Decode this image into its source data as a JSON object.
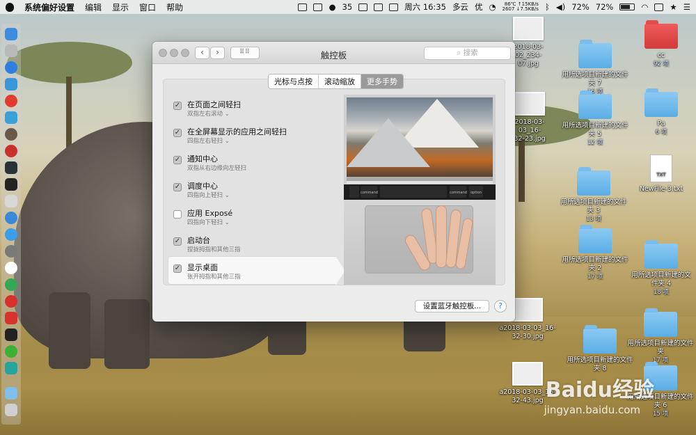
{
  "menubar": {
    "app_name": "系统偏好设置",
    "menus": [
      "编辑",
      "显示",
      "窗口",
      "帮助"
    ],
    "status": {
      "wechat_count": "35",
      "datetime": "周六 16:35",
      "weather": "多云",
      "quality": "优",
      "temp": "86℃",
      "cpu": "2607",
      "net_up": "↑15KB/s",
      "net_down": "↓7.5KB/s",
      "battery_left": "72%",
      "battery_right": "72%"
    }
  },
  "window": {
    "title": "触控板",
    "search_placeholder": "搜索",
    "tabs": [
      "光标与点按",
      "滚动缩放",
      "更多手势"
    ],
    "active_tab": "更多手势",
    "options": [
      {
        "title": "在页面之间轻扫",
        "sub": "双指左右滚动 ⌄",
        "checked": "✓"
      },
      {
        "title": "在全屏幕显示的应用之间轻扫",
        "sub": "四指左右轻扫 ⌄",
        "checked": "✓"
      },
      {
        "title": "通知中心",
        "sub": "双指从右边缘向左轻扫",
        "checked": "✓"
      },
      {
        "title": "调度中心",
        "sub": "四指向上轻扫 ⌄",
        "checked": "✓"
      },
      {
        "title": "应用 Exposé",
        "sub": "四指向下轻扫 ⌄",
        "checked": ""
      },
      {
        "title": "启动台",
        "sub": "捏拢拇指和其他三指",
        "checked": "✓"
      },
      {
        "title": "显示桌面",
        "sub": "张开拇指和其他三指",
        "checked": "✓"
      }
    ],
    "preview_keys": [
      "command",
      "command",
      "option"
    ],
    "bluetooth_button": "设置蓝牙触控板...",
    "help": "?"
  },
  "desktop": {
    "items": [
      {
        "label": "cc",
        "sub": "92 项"
      },
      {
        "label": "用所选项目新建的文件夹 7",
        "sub": "16 项"
      },
      {
        "label": "用所选项目新建的文件夹 5",
        "sub": "12 项"
      },
      {
        "label": "Pa",
        "sub": "6 项"
      },
      {
        "label": "NewFile-3.txt",
        "sub": ""
      },
      {
        "label": "用所选项目新建的文件夹 3",
        "sub": "13 项"
      },
      {
        "label": "用所选项目新建的文件夹 2",
        "sub": "17 项"
      },
      {
        "label": "用所选项目新建的文件夹 4",
        "sub": "18 项"
      },
      {
        "label": "用所选项目新建的文件夹",
        "sub": "17 项"
      },
      {
        "label": "用所选项目新建的文件夹 8",
        "sub": ""
      },
      {
        "label": "用所选项目新建的文件夹 6",
        "sub": "15 项"
      },
      {
        "label": "a2018-03-03_16-32-30.jpg",
        "sub": ""
      },
      {
        "label": "a2018-03-03_16-32-43.jpg",
        "sub": ""
      },
      {
        "label": "2018-03-02_234-07.jpg",
        "sub": ""
      },
      {
        "label": "2018-03-03_16-32-23.jpg",
        "sub": ""
      }
    ],
    "txt_badge": "TXT"
  },
  "watermark": {
    "brand": "Baidu经验",
    "url": "jingyan.baidu.com"
  },
  "colors": {
    "folder_blue": "#5aaee6",
    "folder_red": "#d43a3a",
    "active_tab": "#9a9a9a",
    "help_blue": "#2c7be5"
  }
}
